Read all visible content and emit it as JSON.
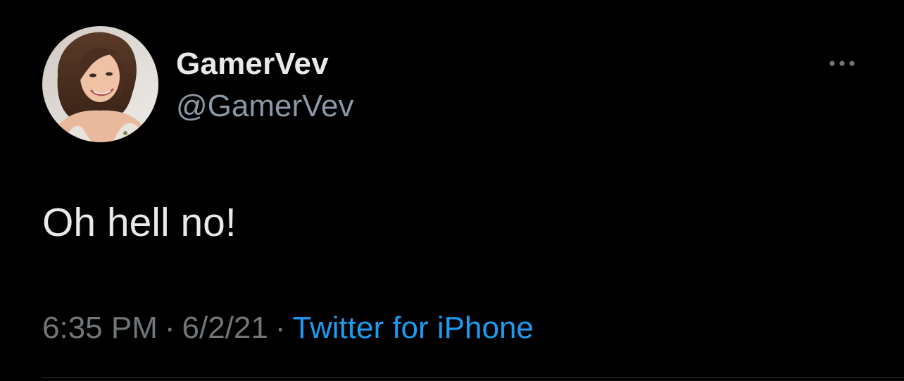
{
  "tweet": {
    "author": {
      "display_name": "GamerVev",
      "handle": "@GamerVev",
      "avatar_icon": "profile-photo"
    },
    "more_icon": "more-horizontal-icon",
    "text": "Oh hell no!",
    "meta": {
      "time": "6:35 PM",
      "separator": "·",
      "date": "6/2/21",
      "source": "Twitter for iPhone"
    }
  },
  "colors": {
    "background": "#000000",
    "primary_text": "#e7e9ea",
    "secondary_text": "#71767b",
    "handle_text": "#8b98a5",
    "link": "#1d9bf0",
    "divider": "#2f3336"
  }
}
